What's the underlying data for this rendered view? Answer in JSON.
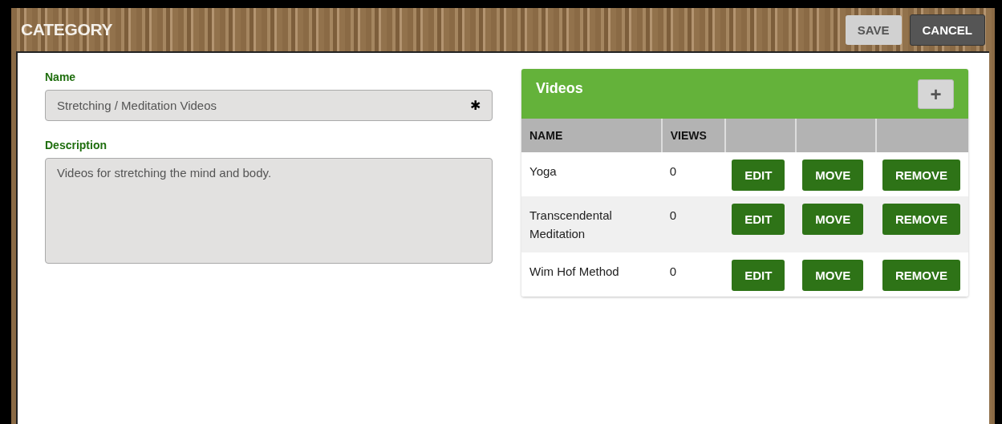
{
  "window": {
    "title": "CATEGORY"
  },
  "header_buttons": [
    {
      "label": "SAVE",
      "kind": "secondary"
    },
    {
      "label": "CANCEL",
      "kind": "dark"
    }
  ],
  "form": {
    "fields": [
      {
        "label": "Name",
        "kind": "input",
        "value": "Stretching / Meditation Videos",
        "required_mark": "✱"
      },
      {
        "label": "Description",
        "kind": "textarea",
        "value": "Videos for stretching the mind and body."
      }
    ]
  },
  "videos": {
    "title": "Videos",
    "add_button": "+",
    "columns": [
      "NAME",
      "VIEWS"
    ],
    "rows": [
      {
        "name": "Yoga",
        "views": "0",
        "actions": [
          "EDIT",
          "MOVE",
          "REMOVE"
        ]
      },
      {
        "name": "Transcendental Meditation",
        "views": "0",
        "actions": [
          "EDIT",
          "MOVE",
          "REMOVE"
        ]
      },
      {
        "name": "Wim Hof Method",
        "views": "0",
        "actions": [
          "EDIT",
          "MOVE",
          "REMOVE"
        ]
      }
    ]
  }
}
